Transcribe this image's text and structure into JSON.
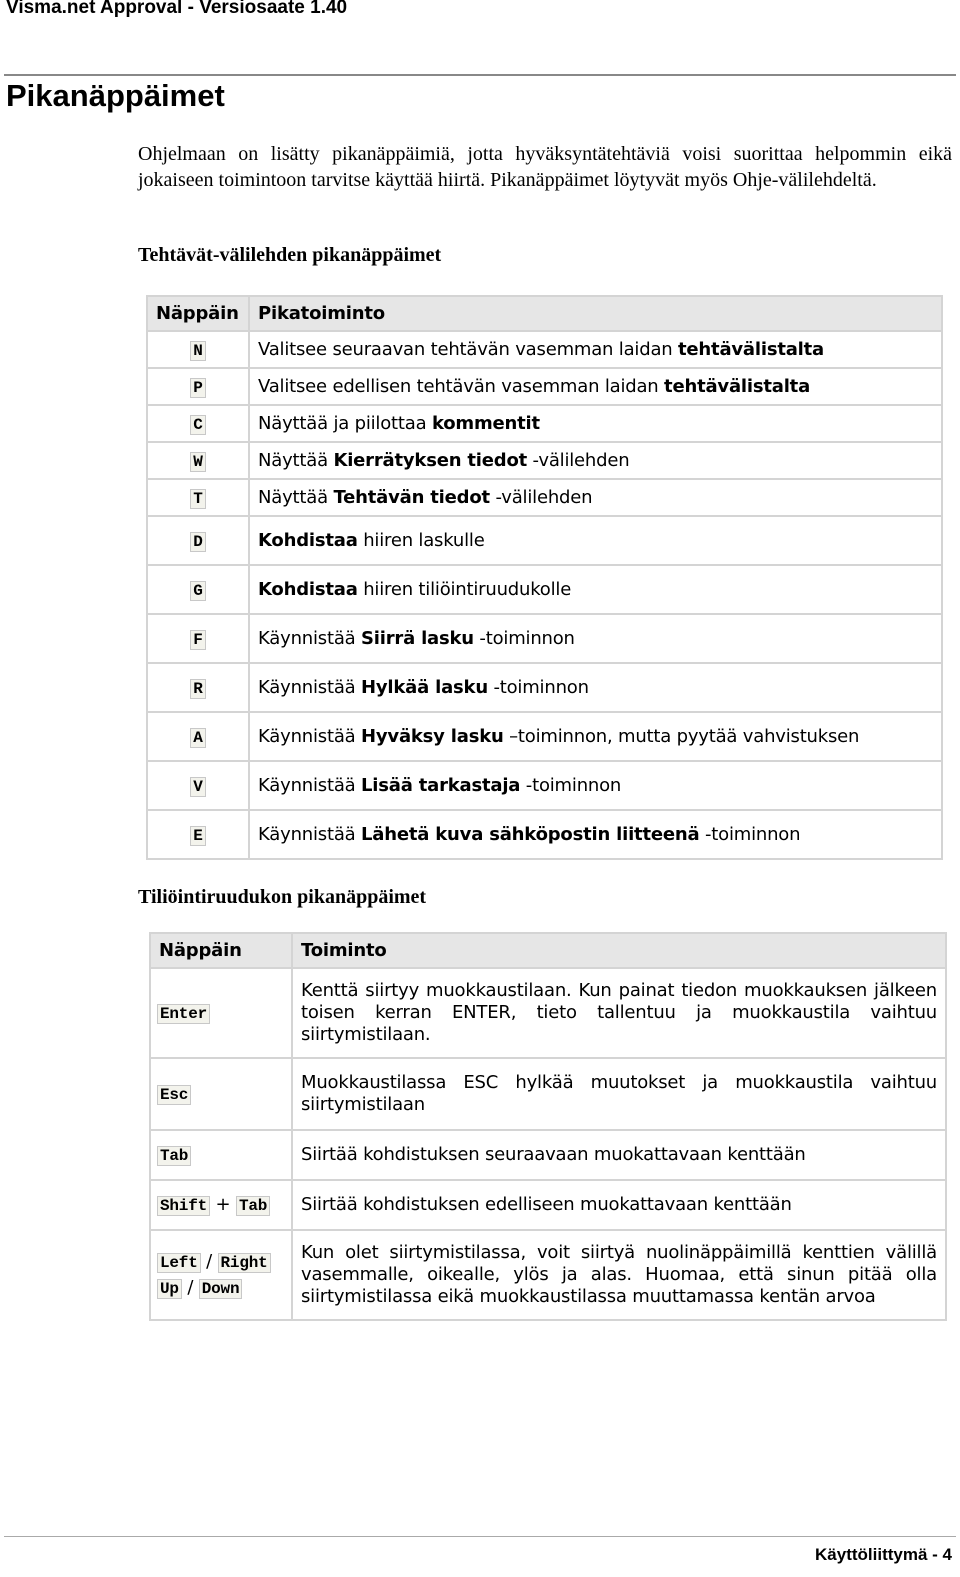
{
  "header": {
    "title": "Visma.net Approval - Versiosaate 1.40"
  },
  "page_title": "Pikanäppäimet",
  "intro": "Ohjelmaan on lisätty pikanäppäimiä, jotta hyväksyntätehtäviä voisi suorittaa helpommin eikä jokaiseen toimintoon tarvitse käyttää hiirtä. Pikanäppäimet löytyvät myös Ohje-välilehdeltä.",
  "section1": {
    "title": "Tehtävät-välilehden pikanäppäimet",
    "headers": [
      "Näppäin",
      "Pikatoiminto"
    ],
    "rows": [
      {
        "key": "N",
        "desc": [
          {
            "t": "Valitsee seuraavan tehtävän vasemman laidan "
          },
          {
            "t": "tehtävälistalta",
            "b": true
          }
        ]
      },
      {
        "key": "P",
        "desc": [
          {
            "t": "Valitsee edellisen tehtävän vasemman laidan "
          },
          {
            "t": "tehtävälistalta",
            "b": true
          }
        ]
      },
      {
        "key": "C",
        "desc": [
          {
            "t": "Näyttää ja piilottaa "
          },
          {
            "t": "kommentit",
            "b": true
          }
        ]
      },
      {
        "key": "W",
        "desc": [
          {
            "t": "Näyttää "
          },
          {
            "t": "Kierrätyksen tiedot",
            "b": true
          },
          {
            "t": " -välilehden"
          }
        ]
      },
      {
        "key": "T",
        "desc": [
          {
            "t": "Näyttää "
          },
          {
            "t": "Tehtävän tiedot",
            "b": true
          },
          {
            "t": " -välilehden"
          }
        ]
      },
      {
        "key": "D",
        "desc": [
          {
            "t": "Kohdistaa",
            "b": true
          },
          {
            "t": " hiiren laskulle"
          }
        ]
      },
      {
        "key": "G",
        "desc": [
          {
            "t": "Kohdistaa",
            "b": true
          },
          {
            "t": " hiiren tiliöintiruudukolle"
          }
        ]
      },
      {
        "key": "F",
        "desc": [
          {
            "t": "Käynnistää "
          },
          {
            "t": "Siirrä lasku",
            "b": true
          },
          {
            "t": " -toiminnon"
          }
        ]
      },
      {
        "key": "R",
        "desc": [
          {
            "t": "Käynnistää "
          },
          {
            "t": "Hylkää lasku",
            "b": true
          },
          {
            "t": " -toiminnon"
          }
        ]
      },
      {
        "key": "A",
        "desc": [
          {
            "t": "Käynnistää "
          },
          {
            "t": "Hyväksy lasku",
            "b": true
          },
          {
            "t": " –toiminnon, mutta pyytää vahvistuksen"
          }
        ]
      },
      {
        "key": "V",
        "desc": [
          {
            "t": "Käynnistää "
          },
          {
            "t": "Lisää tarkastaja",
            "b": true
          },
          {
            "t": " -toiminnon"
          }
        ]
      },
      {
        "key": "E",
        "desc": [
          {
            "t": "Käynnistää "
          },
          {
            "t": "Lähetä kuva sähköpostin liitteenä",
            "b": true
          },
          {
            "t": " -toiminnon"
          }
        ]
      }
    ]
  },
  "section2": {
    "title": "Tiliöintiruudukon pikanäppäimet",
    "headers": [
      "Näppäin",
      "Toiminto"
    ],
    "rows": [
      {
        "keys": [
          "Enter"
        ],
        "desc": "Kenttä siirtyy muokkaustilaan. Kun painat tiedon muokkauksen jälkeen toisen kerran ENTER, tieto tallentuu ja muokkaustila vaihtuu siirtymistilaan."
      },
      {
        "keys": [
          "Esc"
        ],
        "desc": "Muokkaustilassa ESC hylkää muutokset ja muokkaustila vaihtuu siirtymistilaan"
      },
      {
        "keys": [
          "Tab"
        ],
        "desc": "Siirtää kohdistuksen seuraavaan muokattavaan kenttään"
      },
      {
        "keys": [
          "Shift",
          " + ",
          "Tab"
        ],
        "desc": "Siirtää kohdistuksen edelliseen muokattavaan kenttään"
      },
      {
        "keys": [
          "Left",
          " / ",
          "Right",
          "\n",
          "Up",
          " / ",
          "Down"
        ],
        "desc": "Kun olet siirtymistilassa, voit siirtyä nuolinäppäimillä kenttien välillä vasemmalle, oikealle, ylös ja alas. Huomaa, että sinun pitää olla siirtymistilassa eikä muokkaustilassa muuttamassa kentän arvoa"
      }
    ]
  },
  "footer": {
    "page_label": "Käyttöliittymä - 4"
  }
}
